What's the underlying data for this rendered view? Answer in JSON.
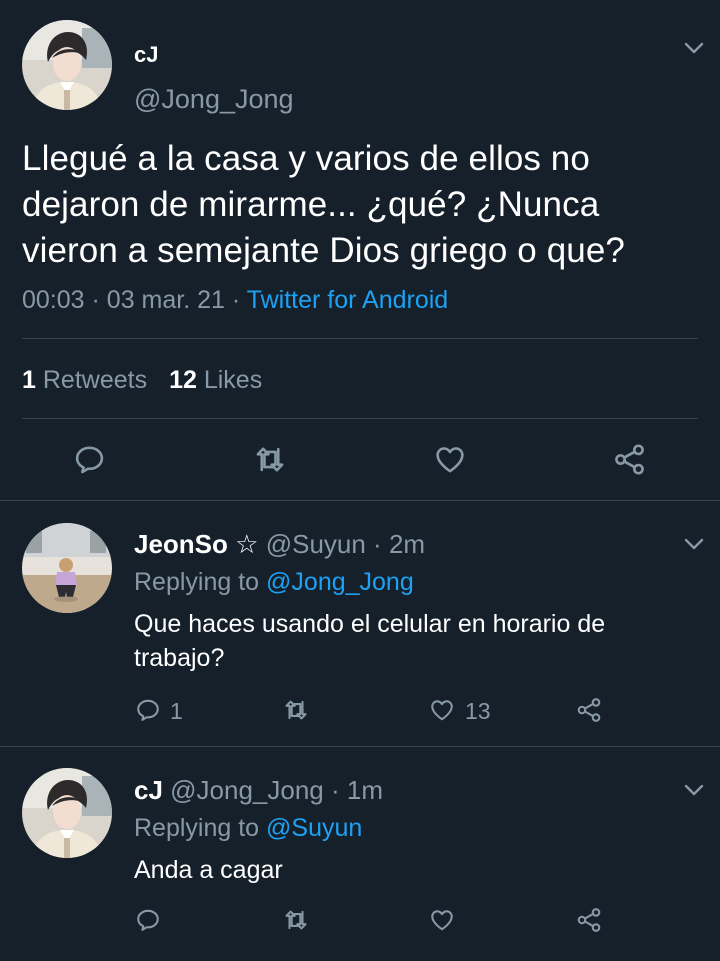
{
  "main_tweet": {
    "name": "cJ",
    "handle": "@Jong_Jong",
    "text": "Llegué a la casa y varios de ellos no dejaron de mirarme... ¿qué? ¿Nunca vieron a semejante Dios griego o que?",
    "time": "00:03",
    "date": "03 mar. 21",
    "source": "Twitter for Android",
    "retweets_count": "1",
    "retweets_label": "Retweets",
    "likes_count": "12",
    "likes_label": "Likes",
    "icons": [
      "reply-icon",
      "retweet-icon",
      "like-icon",
      "share-icon"
    ]
  },
  "replies": [
    {
      "name": "JeonSo",
      "name_symbol": "☆",
      "handle": "@Suyun",
      "time": "2m",
      "replying_prefix": "Replying to",
      "replying_to": "@Jong_Jong",
      "text": "Que haces usando el celular en horario de trabajo?",
      "reply_count": "1",
      "like_count": "13"
    },
    {
      "name": "cJ",
      "handle": "@Jong_Jong",
      "time": "1m",
      "replying_prefix": "Replying to",
      "replying_to": "@Suyun",
      "text": "Anda a cagar",
      "reply_count": "",
      "like_count": ""
    }
  ],
  "colors": {
    "background": "#15202b",
    "text": "#ffffff",
    "secondary": "#8899a6",
    "accent": "#1da1f2",
    "divider": "#38444d"
  }
}
